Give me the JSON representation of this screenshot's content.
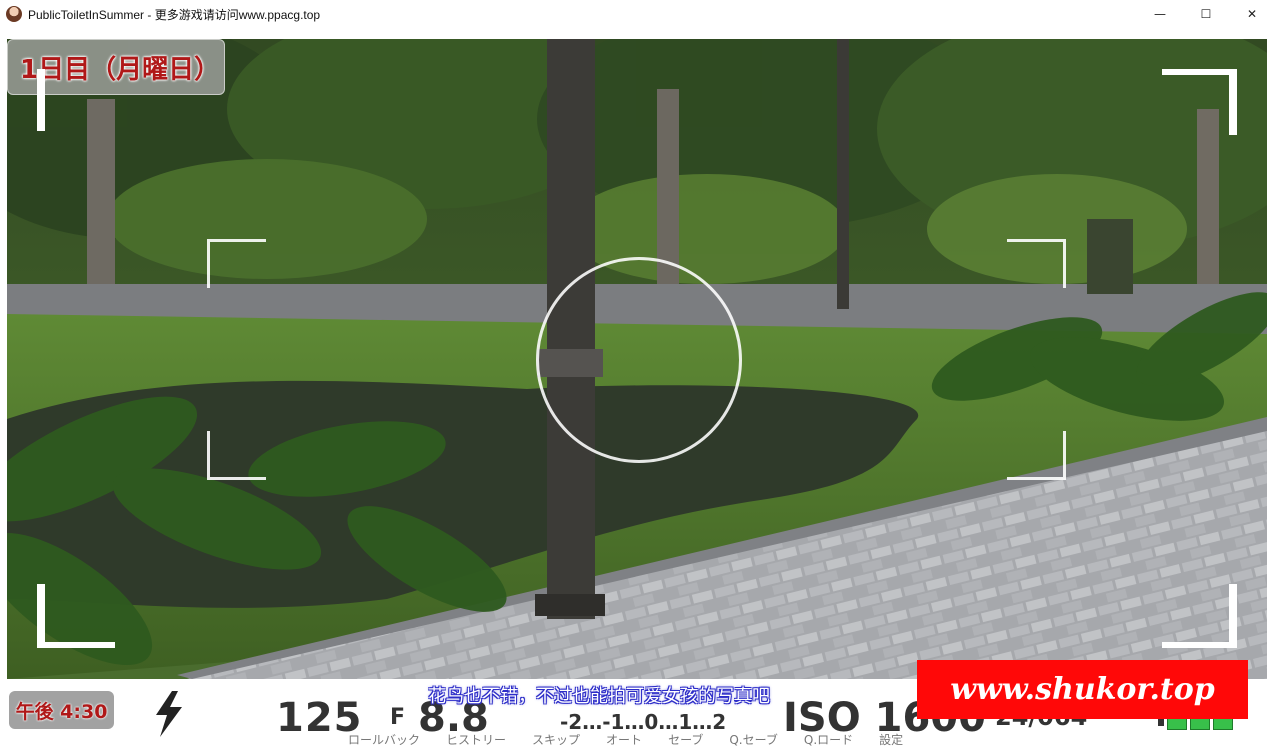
{
  "window": {
    "title": "PublicToiletInSummer - 更多游戏请访问www.ppacg.top",
    "app_icon": "character-portrait-icon",
    "controls": {
      "minimize": "—",
      "maximize": "☐",
      "close": "✕"
    }
  },
  "viewfinder": {
    "day_label": "1日目（月曜日）",
    "focus_ring": "focus-circle"
  },
  "hud": {
    "time_label": "午後 4:30",
    "flash_icon": "lightning-bolt-icon",
    "shutter_speed": "125",
    "aperture_prefix": "F",
    "aperture_value": "8.8",
    "exposure_scale": "-2…-1…0…1…2",
    "iso": "ISO 1600",
    "shot_count": "24/064",
    "battery_icon": "battery-icon",
    "subtitle": "花鸟也不错，不过也能拍可爱女孩的写真吧",
    "menu": {
      "rollback": "ロールバック",
      "history": "ヒストリー",
      "skip": "スキップ",
      "auto": "オート",
      "save": "セーブ",
      "quick_save": "Q.セーブ",
      "quick_load": "Q.ロード",
      "settings": "設定"
    }
  },
  "watermark": {
    "text": "www.shukor.top"
  },
  "colors": {
    "accent_red": "#b01818",
    "watermark_bg": "#ff0808",
    "subtitle_outline": "#2c2cc8",
    "battery_green": "#38c04a"
  }
}
